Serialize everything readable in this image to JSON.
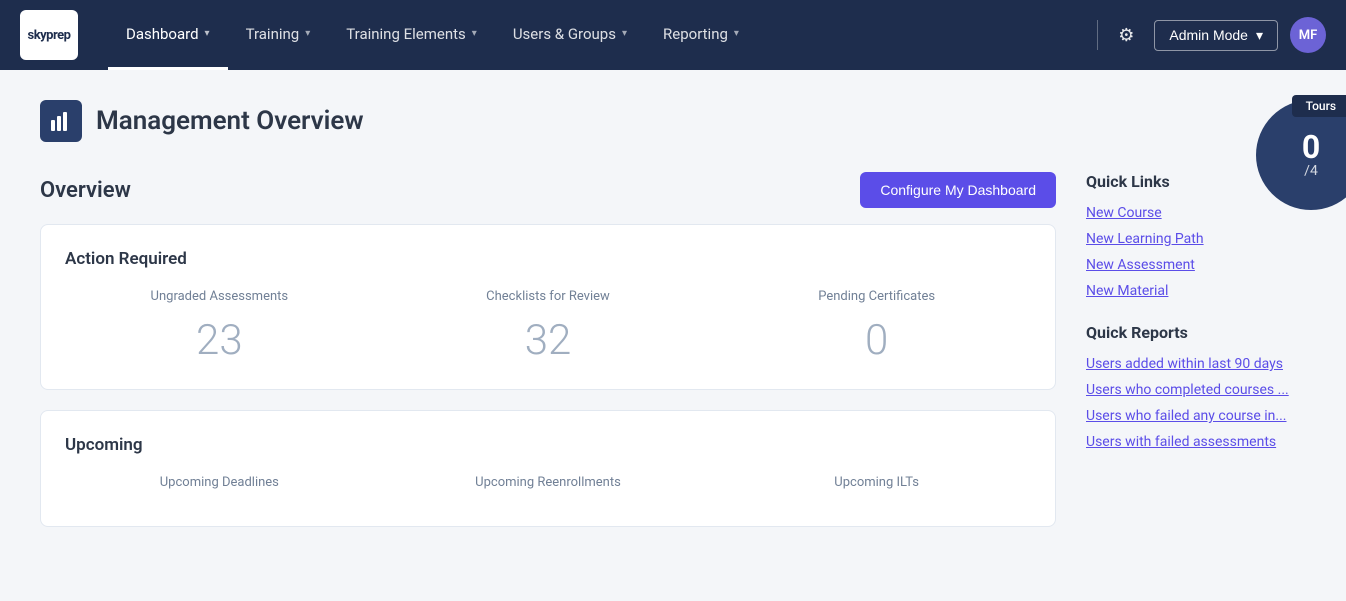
{
  "logo": {
    "text": "skyprep"
  },
  "nav": {
    "items": [
      {
        "label": "Dashboard",
        "hasChevron": true,
        "active": true
      },
      {
        "label": "Training",
        "hasChevron": true,
        "active": false
      },
      {
        "label": "Training Elements",
        "hasChevron": true,
        "active": false
      },
      {
        "label": "Users & Groups",
        "hasChevron": true,
        "active": false
      },
      {
        "label": "Reporting",
        "hasChevron": true,
        "active": false
      }
    ],
    "adminMode": "Admin Mode",
    "avatarInitials": "MF"
  },
  "tours": {
    "label": "Tours",
    "current": "0",
    "total": "/4"
  },
  "page": {
    "title": "Management Overview",
    "iconLabel": "bar-chart-icon"
  },
  "overview": {
    "title": "Overview",
    "configureBtn": "Configure My Dashboard"
  },
  "actionRequired": {
    "title": "Action Required",
    "stats": [
      {
        "label": "Ungraded Assessments",
        "value": "23"
      },
      {
        "label": "Checklists for Review",
        "value": "32"
      },
      {
        "label": "Pending Certificates",
        "value": "0"
      }
    ]
  },
  "upcoming": {
    "title": "Upcoming",
    "stats": [
      {
        "label": "Upcoming Deadlines",
        "value": ""
      },
      {
        "label": "Upcoming Reenrollments",
        "value": ""
      },
      {
        "label": "Upcoming ILTs",
        "value": ""
      }
    ]
  },
  "quickLinks": {
    "title": "Quick Links",
    "links": [
      "New Course",
      "New Learning Path",
      "New Assessment",
      "New Material"
    ]
  },
  "quickReports": {
    "title": "Quick Reports",
    "links": [
      "Users added within last 90 days",
      "Users who completed courses ...",
      "Users who failed any course in...",
      "Users with failed assessments"
    ]
  }
}
